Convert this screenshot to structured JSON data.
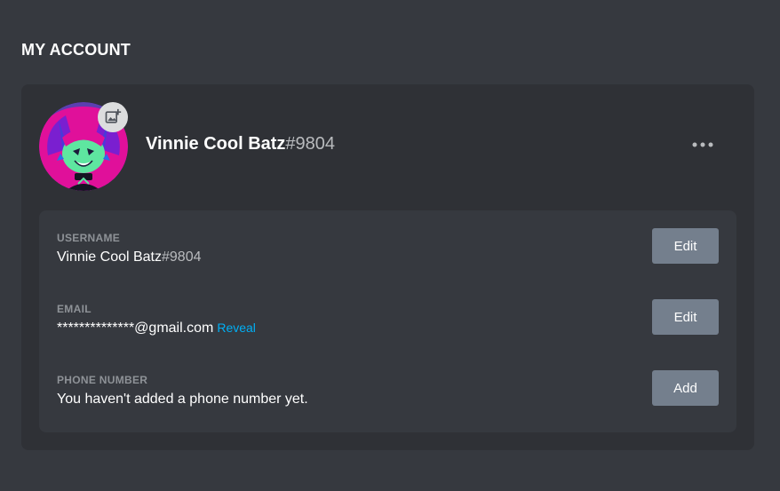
{
  "section": {
    "title": "MY ACCOUNT"
  },
  "profile": {
    "display_name": "Vinnie Cool Batz",
    "discriminator": "#9804",
    "avatar_icon": "avatar-image",
    "upload_icon": "add-image-icon",
    "menu_icon": "more-horizontal-icon"
  },
  "fields": {
    "username": {
      "label": "USERNAME",
      "name": "Vinnie Cool Batz",
      "discriminator": "#9804",
      "button": "Edit"
    },
    "email": {
      "label": "EMAIL",
      "masked": "**************@gmail.com",
      "reveal": "Reveal",
      "button": "Edit"
    },
    "phone": {
      "label": "PHONE NUMBER",
      "value": "You haven't added a phone number yet.",
      "button": "Add"
    }
  },
  "colors": {
    "background": "#36393f",
    "card": "#2f3136",
    "button": "#747f8d",
    "link": "#00aff4",
    "label": "#8e9297"
  }
}
